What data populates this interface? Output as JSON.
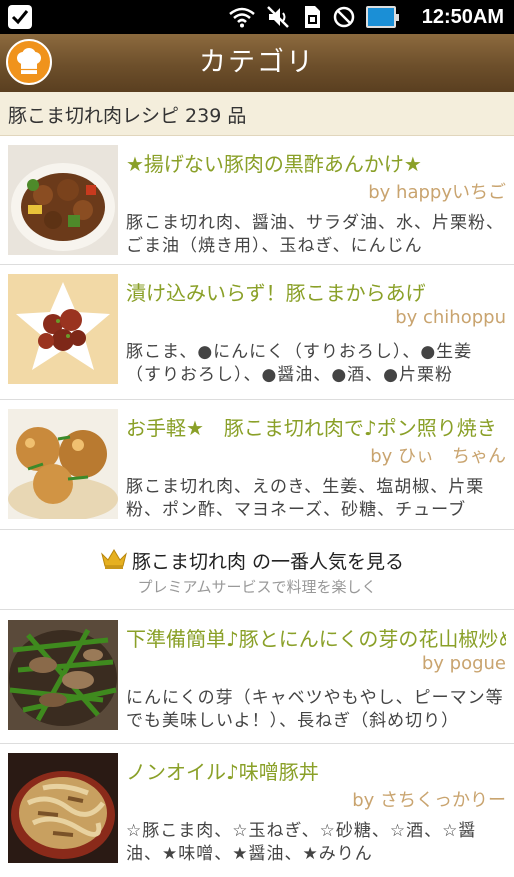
{
  "status_bar": {
    "time": "12:50AM"
  },
  "header": {
    "title": "カテゴリ"
  },
  "count_bar": {
    "text": "豚こま切れ肉レシピ 239 品"
  },
  "recipes": [
    {
      "title": "★揚げない豚肉の黒酢あんかけ★",
      "author": "by happyいちご",
      "ingredients": "豚こま切れ肉、醤油、サラダ油、水、片栗粉、ごま油（焼き用）、玉ねぎ、にんじん"
    },
    {
      "title": "漬け込みいらず！豚こまからあげ",
      "author": "by chihoppu",
      "ingredients": "豚こま、●にんにく（すりおろし）、●生姜（すりおろし）、●醤油、●酒、●片栗粉"
    },
    {
      "title": "お手軽★　豚こま切れ肉で♪ポン照り焼き",
      "author": "by ひぃ　ちゃん",
      "ingredients": "豚こま切れ肉、えのき、生姜、塩胡椒、片栗粉、ポン酢、マヨネーズ、砂糖、チューブ"
    },
    {
      "title": "下準備簡単♪豚とにんにくの芽の花山椒炒め",
      "author": "by pogue",
      "ingredients": "にんにくの芽（キャベツやもやし、ピーマン等でも美味しいよ！）、長ねぎ（斜め切り）"
    },
    {
      "title": "ノンオイル♪味噌豚丼",
      "author": "by さちくっかりー",
      "ingredients": "☆豚こま肉、☆玉ねぎ、☆砂糖、☆酒、☆醤油、★味噌、★醤油、★みりん"
    }
  ],
  "premium": {
    "main": "豚こま切れ肉 の一番人気を見る",
    "sub": "プレミアムサービスで料理を楽しく"
  },
  "icons": [
    "checkmark-icon",
    "wifi-icon",
    "mute-icon",
    "sim-icon",
    "no-signal-icon",
    "battery-icon",
    "chef-hat-icon",
    "crown-icon"
  ],
  "colors": {
    "accent_title": "#8aa028",
    "author": "#c9a46f",
    "header": "#6d4f2b",
    "chef_badge": "#f0931c"
  }
}
